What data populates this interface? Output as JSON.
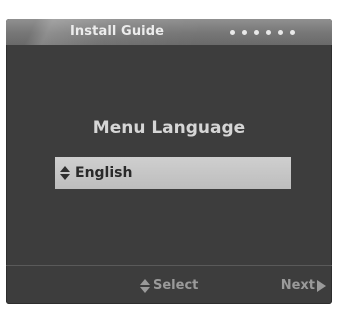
{
  "window": {
    "title": "Install Guide",
    "progress_steps": 6,
    "colors": {
      "background": "#3d3d3d",
      "title_bar": "#767676",
      "highlight": "#c6c6c6",
      "footer_text": "#9a9a9a"
    }
  },
  "main": {
    "heading": "Menu Language",
    "selector": {
      "icon": "up-down-arrows-icon",
      "value": "English"
    }
  },
  "footer": {
    "select": {
      "icon": "up-down-arrows-icon",
      "label": "Select"
    },
    "next": {
      "label": "Next",
      "icon": "play-right-icon"
    }
  }
}
